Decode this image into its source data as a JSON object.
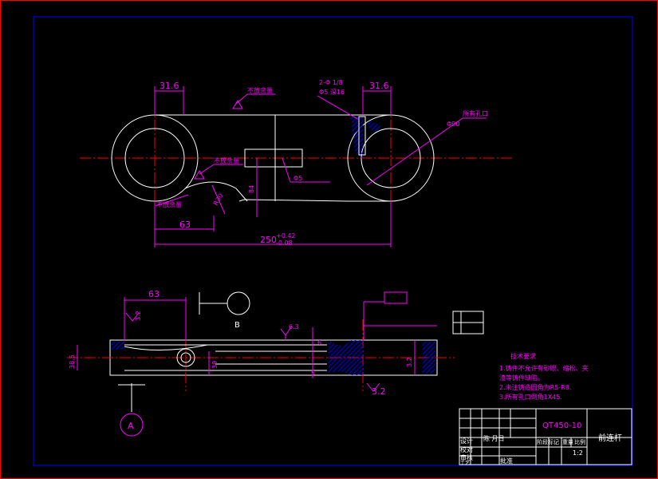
{
  "dims": {
    "d1": "31.6",
    "d2": "31.6",
    "d3": "63",
    "d4": "250",
    "d4_tol_upper": "+0.42",
    "d4_tol_lower": "-0.08",
    "d5": "84",
    "d6": "R30",
    "d7": "63",
    "d8": "3.2",
    "d9": "39",
    "d10": "3.2",
    "d11": "3.2",
    "d12": "6.3",
    "d13": "38.5",
    "d14": "6",
    "d15": "5",
    "d16": "Φ90",
    "d17": "Φ5",
    "d18": "6.3"
  },
  "notes": {
    "no_allowance_1": "不放余量",
    "no_allowance_2": "不放余量",
    "no_allowance_3": "不放余量",
    "hole_spec": "2-Φ 1/8",
    "hole_spec2": "Φ5 深16",
    "section_label": "B",
    "view_label": "A",
    "fit_note": "所有孔口"
  },
  "tech": {
    "title": "技术要求",
    "line1": "1.铸件不允许有砂眼、缩松、夹",
    "line2": "  渣等铸件缺陷。",
    "line3": "2.未注铸造圆角为R5-R8.",
    "line4": "3.所有孔口倒角1X45."
  },
  "title_block": {
    "material": "QT450-10",
    "part_name": "前连杆",
    "scale": "1:2",
    "rows": [
      "设计",
      "校对",
      "审核",
      "工艺"
    ],
    "designer": "陈 月日",
    "approve": "批准",
    "col_stage": "阶段标记",
    "col_weight": "重量",
    "col_scale": "比例"
  }
}
